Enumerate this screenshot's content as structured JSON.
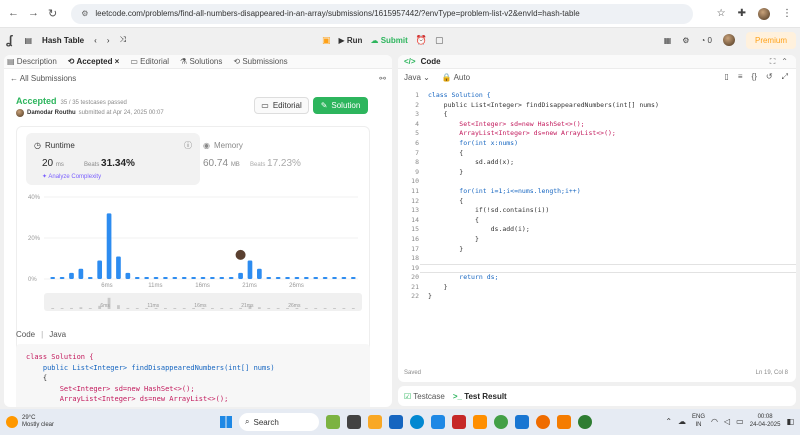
{
  "browser": {
    "url": "leetcode.com/problems/find-all-numbers-disappeared-in-an-array/submissions/1615957442/?envType=problem-list-v2&envId=hash-table"
  },
  "topbar": {
    "list_name": "Hash Table",
    "run": "Run",
    "submit": "Submit",
    "notif_count": "0",
    "premium": "Premium"
  },
  "left_tabs": [
    "Description",
    "Accepted",
    "Editorial",
    "Solutions",
    "Submissions"
  ],
  "back_label": "All Submissions",
  "result": {
    "status": "Accepted",
    "testcases": "35 / 35 testcases passed",
    "author": "Damodar Routhu",
    "submitted": "submitted at Apr 24, 2025 00:07",
    "editorial_btn": "Editorial",
    "solution_btn": "Solution"
  },
  "runtime": {
    "label": "Runtime",
    "value": "20",
    "unit": "ms",
    "beats_label": "Beats",
    "beats": "31.34%",
    "analyze": "Analyze Complexity"
  },
  "memory": {
    "label": "Memory",
    "value": "60.74",
    "unit": "MB",
    "beats_label": "Beats",
    "beats": "17.23%"
  },
  "chart_data": {
    "type": "bar",
    "y_ticks": [
      "40%",
      "20%",
      "0%"
    ],
    "x_ticks": [
      "6ms",
      "11ms",
      "16ms",
      "21ms",
      "26ms"
    ],
    "ylim": [
      0,
      40
    ],
    "values": [
      1,
      1,
      3,
      5,
      1,
      9,
      32,
      11,
      3,
      1,
      1,
      1,
      1,
      1,
      1,
      1,
      1,
      1,
      1,
      1,
      3,
      9,
      5,
      1,
      1,
      1,
      1,
      1,
      1,
      1,
      1,
      1,
      1
    ],
    "highlight_index": 20,
    "bar_color": "#2d8cf0",
    "mini_ticks": [
      "6ms",
      "11ms",
      "16ms",
      "21ms",
      "26ms"
    ]
  },
  "code_preview": {
    "label": "Code",
    "lang": "Java",
    "lines": [
      "class Solution {",
      "    public List<Integer> findDisappearedNumbers(int[] nums)",
      "    {",
      "        Set<Integer> sd=new HashSet<>();",
      "        ArrayList<Integer> ds=new ArrayList<>();"
    ]
  },
  "editor": {
    "tab": "Code",
    "lang": "Java",
    "auto": "Auto",
    "line_numbers": [
      "1",
      "2",
      "3",
      "4",
      "5",
      "6",
      "7",
      "8",
      "9",
      "10",
      "11",
      "12",
      "13",
      "14",
      "15",
      "16",
      "17",
      "18",
      "19",
      "20",
      "21",
      "22"
    ],
    "lines": [
      "class Solution {",
      "    public List<Integer> findDisappearedNumbers(int[] nums)",
      "    {",
      "        Set<Integer> sd=new HashSet<>();",
      "        ArrayList<Integer> ds=new ArrayList<>();",
      "        for(int x:nums)",
      "        {",
      "            sd.add(x);",
      "        }",
      "",
      "        for(int i=1;i<=nums.length;i++)",
      "        {",
      "            if(!sd.contains(i))",
      "            {",
      "                ds.add(i);",
      "            }",
      "        }",
      "",
      "",
      "        return ds;",
      "    }",
      "}"
    ],
    "saved": "Saved",
    "cursor": "Ln 19, Col 8"
  },
  "bottom_tabs": {
    "testcase": "Testcase",
    "result": "Test Result"
  },
  "taskbar": {
    "temp": "29°C",
    "weather": "Mostly clear",
    "search": "Search",
    "lang1": "ENG",
    "lang2": "IN",
    "time": "00:08",
    "date": "24-04-2025"
  }
}
